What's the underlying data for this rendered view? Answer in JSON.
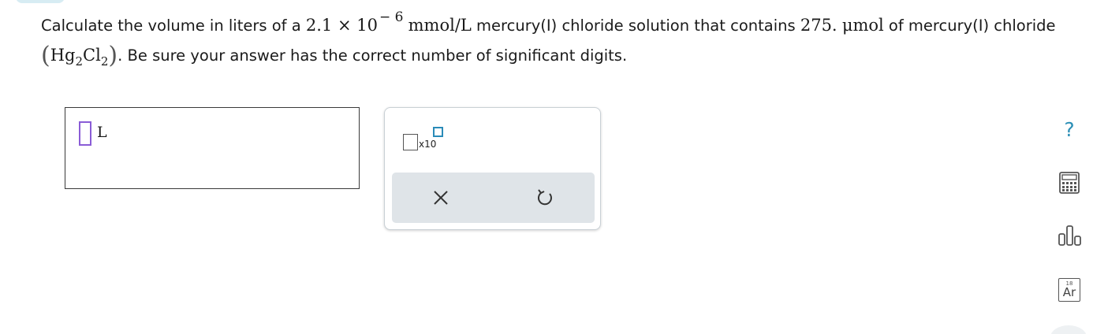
{
  "question": {
    "text_before_concentration": "Calculate the volume in liters of a ",
    "concentration_coefficient": "2.1 × 10",
    "concentration_exponent": "− 6",
    "concentration_unit": "mmol/L",
    "text_mid": " mercury(I) chloride solution that contains ",
    "amount_value": "275.",
    "amount_unit": "μmol",
    "text_of": " of mercury(I) chloride ",
    "paren_open": "(",
    "formula_hg": "Hg",
    "formula_hg_sub": "2",
    "formula_cl": "Cl",
    "formula_cl_sub": "2",
    "paren_close": ")",
    "text_end": ". Be sure your answer has the correct number of significant digits."
  },
  "answer": {
    "unit": "L",
    "value": ""
  },
  "tools": {
    "sci_notation_label": "x10",
    "clear_icon": "close-icon",
    "undo_icon": "undo-icon"
  },
  "sidebar": {
    "help_symbol": "?",
    "help_icon": "help-icon",
    "calculator_icon": "calculator-icon",
    "chart_icon": "bar-chart-icon",
    "periodic_table_number": "18",
    "periodic_table_symbol": "Ar"
  },
  "colors": {
    "accent": "#2c8fb6",
    "cursor": "#8a5cd6",
    "button_row_bg": "#dfe4e8"
  }
}
